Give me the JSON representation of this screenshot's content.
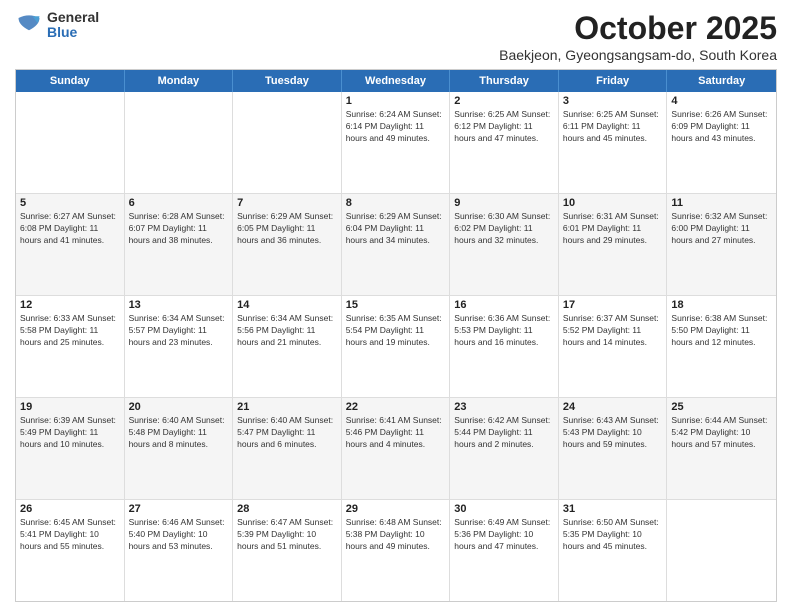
{
  "logo": {
    "general": "General",
    "blue": "Blue"
  },
  "title": "October 2025",
  "location": "Baekjeon, Gyeongsangsam-do, South Korea",
  "days": [
    "Sunday",
    "Monday",
    "Tuesday",
    "Wednesday",
    "Thursday",
    "Friday",
    "Saturday"
  ],
  "weeks": [
    [
      {
        "day": "",
        "info": ""
      },
      {
        "day": "",
        "info": ""
      },
      {
        "day": "",
        "info": ""
      },
      {
        "day": "1",
        "info": "Sunrise: 6:24 AM\nSunset: 6:14 PM\nDaylight: 11 hours\nand 49 minutes."
      },
      {
        "day": "2",
        "info": "Sunrise: 6:25 AM\nSunset: 6:12 PM\nDaylight: 11 hours\nand 47 minutes."
      },
      {
        "day": "3",
        "info": "Sunrise: 6:25 AM\nSunset: 6:11 PM\nDaylight: 11 hours\nand 45 minutes."
      },
      {
        "day": "4",
        "info": "Sunrise: 6:26 AM\nSunset: 6:09 PM\nDaylight: 11 hours\nand 43 minutes."
      }
    ],
    [
      {
        "day": "5",
        "info": "Sunrise: 6:27 AM\nSunset: 6:08 PM\nDaylight: 11 hours\nand 41 minutes."
      },
      {
        "day": "6",
        "info": "Sunrise: 6:28 AM\nSunset: 6:07 PM\nDaylight: 11 hours\nand 38 minutes."
      },
      {
        "day": "7",
        "info": "Sunrise: 6:29 AM\nSunset: 6:05 PM\nDaylight: 11 hours\nand 36 minutes."
      },
      {
        "day": "8",
        "info": "Sunrise: 6:29 AM\nSunset: 6:04 PM\nDaylight: 11 hours\nand 34 minutes."
      },
      {
        "day": "9",
        "info": "Sunrise: 6:30 AM\nSunset: 6:02 PM\nDaylight: 11 hours\nand 32 minutes."
      },
      {
        "day": "10",
        "info": "Sunrise: 6:31 AM\nSunset: 6:01 PM\nDaylight: 11 hours\nand 29 minutes."
      },
      {
        "day": "11",
        "info": "Sunrise: 6:32 AM\nSunset: 6:00 PM\nDaylight: 11 hours\nand 27 minutes."
      }
    ],
    [
      {
        "day": "12",
        "info": "Sunrise: 6:33 AM\nSunset: 5:58 PM\nDaylight: 11 hours\nand 25 minutes."
      },
      {
        "day": "13",
        "info": "Sunrise: 6:34 AM\nSunset: 5:57 PM\nDaylight: 11 hours\nand 23 minutes."
      },
      {
        "day": "14",
        "info": "Sunrise: 6:34 AM\nSunset: 5:56 PM\nDaylight: 11 hours\nand 21 minutes."
      },
      {
        "day": "15",
        "info": "Sunrise: 6:35 AM\nSunset: 5:54 PM\nDaylight: 11 hours\nand 19 minutes."
      },
      {
        "day": "16",
        "info": "Sunrise: 6:36 AM\nSunset: 5:53 PM\nDaylight: 11 hours\nand 16 minutes."
      },
      {
        "day": "17",
        "info": "Sunrise: 6:37 AM\nSunset: 5:52 PM\nDaylight: 11 hours\nand 14 minutes."
      },
      {
        "day": "18",
        "info": "Sunrise: 6:38 AM\nSunset: 5:50 PM\nDaylight: 11 hours\nand 12 minutes."
      }
    ],
    [
      {
        "day": "19",
        "info": "Sunrise: 6:39 AM\nSunset: 5:49 PM\nDaylight: 11 hours\nand 10 minutes."
      },
      {
        "day": "20",
        "info": "Sunrise: 6:40 AM\nSunset: 5:48 PM\nDaylight: 11 hours\nand 8 minutes."
      },
      {
        "day": "21",
        "info": "Sunrise: 6:40 AM\nSunset: 5:47 PM\nDaylight: 11 hours\nand 6 minutes."
      },
      {
        "day": "22",
        "info": "Sunrise: 6:41 AM\nSunset: 5:46 PM\nDaylight: 11 hours\nand 4 minutes."
      },
      {
        "day": "23",
        "info": "Sunrise: 6:42 AM\nSunset: 5:44 PM\nDaylight: 11 hours\nand 2 minutes."
      },
      {
        "day": "24",
        "info": "Sunrise: 6:43 AM\nSunset: 5:43 PM\nDaylight: 10 hours\nand 59 minutes."
      },
      {
        "day": "25",
        "info": "Sunrise: 6:44 AM\nSunset: 5:42 PM\nDaylight: 10 hours\nand 57 minutes."
      }
    ],
    [
      {
        "day": "26",
        "info": "Sunrise: 6:45 AM\nSunset: 5:41 PM\nDaylight: 10 hours\nand 55 minutes."
      },
      {
        "day": "27",
        "info": "Sunrise: 6:46 AM\nSunset: 5:40 PM\nDaylight: 10 hours\nand 53 minutes."
      },
      {
        "day": "28",
        "info": "Sunrise: 6:47 AM\nSunset: 5:39 PM\nDaylight: 10 hours\nand 51 minutes."
      },
      {
        "day": "29",
        "info": "Sunrise: 6:48 AM\nSunset: 5:38 PM\nDaylight: 10 hours\nand 49 minutes."
      },
      {
        "day": "30",
        "info": "Sunrise: 6:49 AM\nSunset: 5:36 PM\nDaylight: 10 hours\nand 47 minutes."
      },
      {
        "day": "31",
        "info": "Sunrise: 6:50 AM\nSunset: 5:35 PM\nDaylight: 10 hours\nand 45 minutes."
      },
      {
        "day": "",
        "info": ""
      }
    ]
  ]
}
